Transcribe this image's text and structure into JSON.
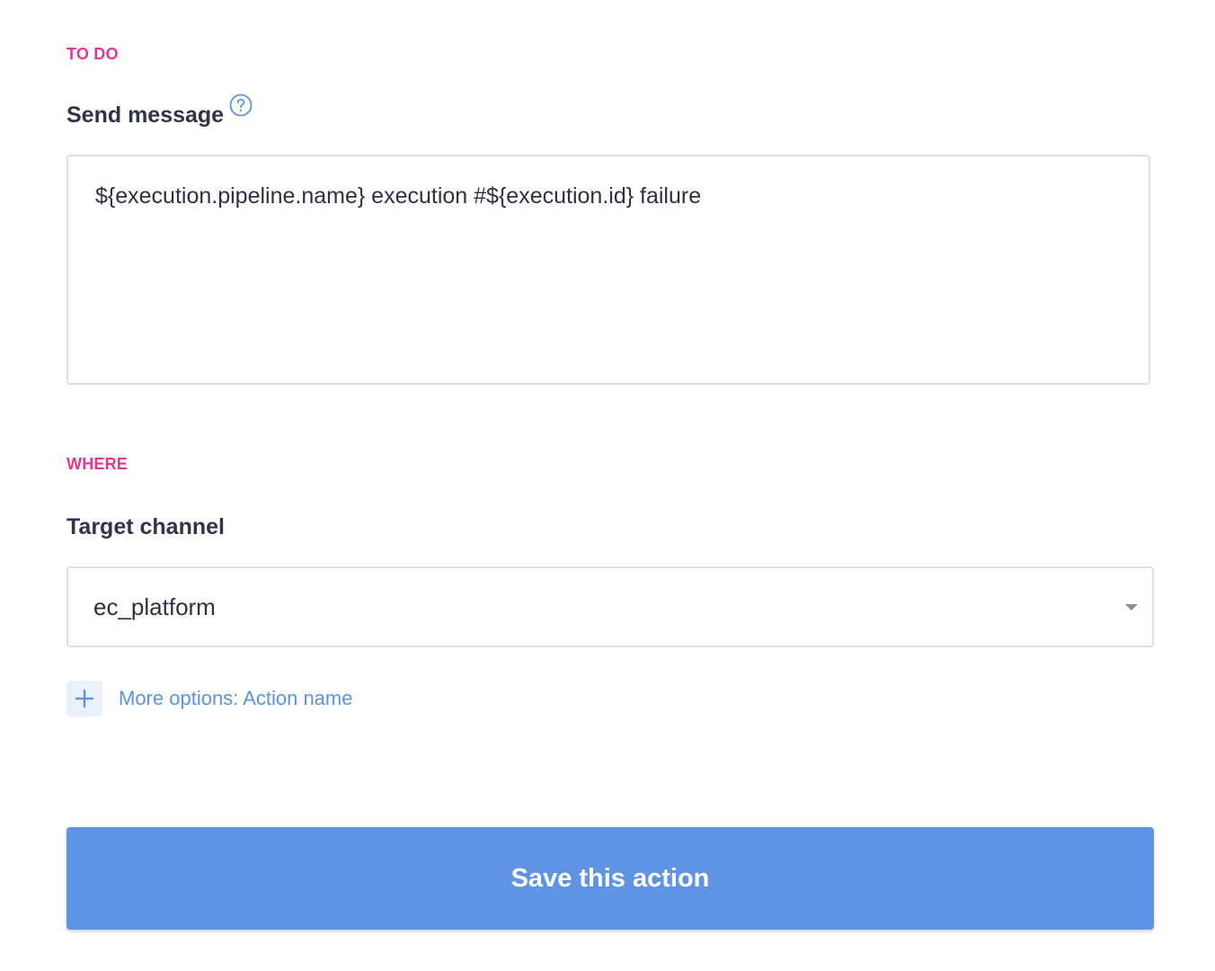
{
  "todo_section": {
    "label": "TO DO",
    "field_label": "Send message",
    "help_icon": "question-circle-icon",
    "message_value": "${execution.pipeline.name} execution #${execution.id} failure"
  },
  "where_section": {
    "label": "WHERE",
    "field_label": "Target channel",
    "channel_value": "ec_platform",
    "caret_icon": "caret-down-icon"
  },
  "more_options": {
    "icon": "plus-icon",
    "label": "More options: Action name"
  },
  "save_button": {
    "label": "Save this action"
  },
  "colors": {
    "section_label": "#e6378f",
    "accent": "#5f94e4",
    "link": "#5b94e2",
    "text": "#2f3142",
    "border": "#dcdfe9"
  }
}
